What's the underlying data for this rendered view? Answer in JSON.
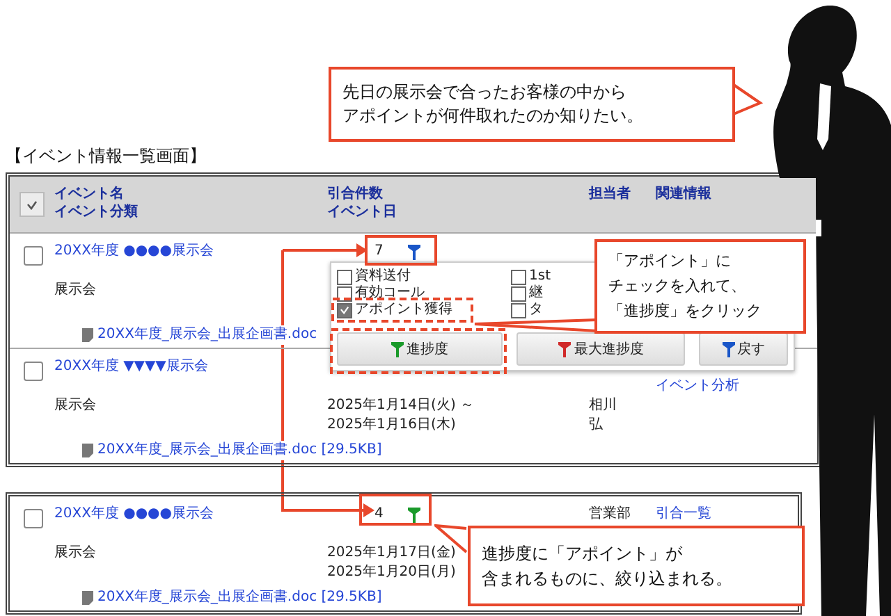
{
  "top_callout": {
    "lines": [
      "先日の展示会で合ったお客様の中から",
      "アポイントが何件取れたのか知りたい。"
    ]
  },
  "screen_title": "【イベント情報一覧画面】",
  "table": {
    "columns": [
      {
        "lines": [
          "イベント名",
          "イベント分類"
        ]
      },
      {
        "lines": [
          "引合件数",
          "イベント日"
        ]
      },
      {
        "lines": [
          "担当者"
        ]
      },
      {
        "lines": [
          "関連情報"
        ]
      }
    ],
    "rows": [
      {
        "checked": false,
        "name": "20XX年度 ●●●●展示会",
        "category": "展示会",
        "count": "7",
        "color": "#1a56c8",
        "file": "20XX年度_展示会_出展企画書.doc"
      },
      {
        "checked": false,
        "name": "20XX年度 ▼▼▼▼展示会",
        "category": "展示会",
        "dates": [
          "2025年1月14日(火) ～",
          "2025年1月16日(木)"
        ],
        "owner": [
          "相川",
          "弘"
        ],
        "related": [
          "イベント分析"
        ],
        "file": "20XX年度_展示会_出展企画書.doc [29.5KB]"
      }
    ]
  },
  "filter_popup": {
    "options": [
      {
        "label": "資料送付",
        "checked": false
      },
      {
        "label": "1st",
        "checked": false
      },
      {
        "label": "有効コール",
        "checked": false
      },
      {
        "label": "継",
        "checked": false
      },
      {
        "label": "アポイント獲得",
        "checked": true
      },
      {
        "label": "タ",
        "checked": false
      }
    ],
    "buttons": [
      {
        "label": "進捗度",
        "color": "#1a9a2a"
      },
      {
        "label": "最大進捗度",
        "color": "#d02a2a"
      },
      {
        "label": "戻す",
        "color": "#1a56c8"
      }
    ]
  },
  "instruction_callout": {
    "lines": [
      "「アポイント」に",
      "チェックを入れて、",
      "「進捗度」をクリック"
    ]
  },
  "result_table": {
    "rows": [
      {
        "checked": false,
        "name": "20XX年度 ●●●●展示会",
        "category": "展示会",
        "count": "4",
        "color": "#1a9a2a",
        "dates": [
          "2025年1月17日(金)",
          "2025年1月20日(月)"
        ],
        "owner": [
          "営業部"
        ],
        "related": [
          "引合一覧"
        ],
        "file": "20XX年度_展示会_出展企画書.doc [29.5KB]"
      }
    ]
  },
  "result_callout": {
    "lines": [
      "進捗度に「アポイント」が",
      "含まれるものに、絞り込まれる。"
    ]
  }
}
